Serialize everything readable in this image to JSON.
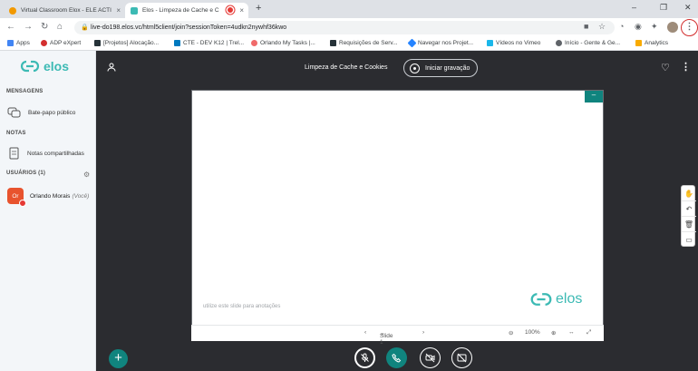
{
  "browser": {
    "tabs": [
      {
        "title": "Virtual Classroom Elox - ELE ACTI"
      },
      {
        "title": "Elos - Limpeza de Cache e C"
      }
    ],
    "url": "live-do198.elos.vc/html5client/join?sessionToken=4udkn2nywhf36kwo",
    "bookmarks": [
      "Apps",
      "ADP eXpert",
      "[Projetos] Alocação...",
      "CTE - DEV K12 | Trel...",
      "Orlando My Tasks |...",
      "Requisições de Serv...",
      "Navegar nos Projet...",
      "Vídeos no Vimeo",
      "Início - Gente & Ge...",
      "Analytics"
    ]
  },
  "sidebar": {
    "logo": "elos",
    "messages_header": "MENSAGENS",
    "public_chat": "Bate-papo público",
    "notes_header": "NOTAS",
    "shared_notes": "Notas compartilhadas",
    "users_header": "USUÁRIOS (1)",
    "user": {
      "initials": "Or",
      "name": "Orlando Morais",
      "you": "(Você)"
    }
  },
  "header": {
    "title": "Limpeza de Cache e Cookies",
    "record_label": "Iniciar gravação"
  },
  "presentation": {
    "note": "utilize este slide para anotações",
    "logo": "elos",
    "slide_label": "Slide 1",
    "zoom": "100%"
  },
  "colors": {
    "accent": "#10847e",
    "brand": "#3cbab4",
    "main_bg": "#2b2c30"
  }
}
